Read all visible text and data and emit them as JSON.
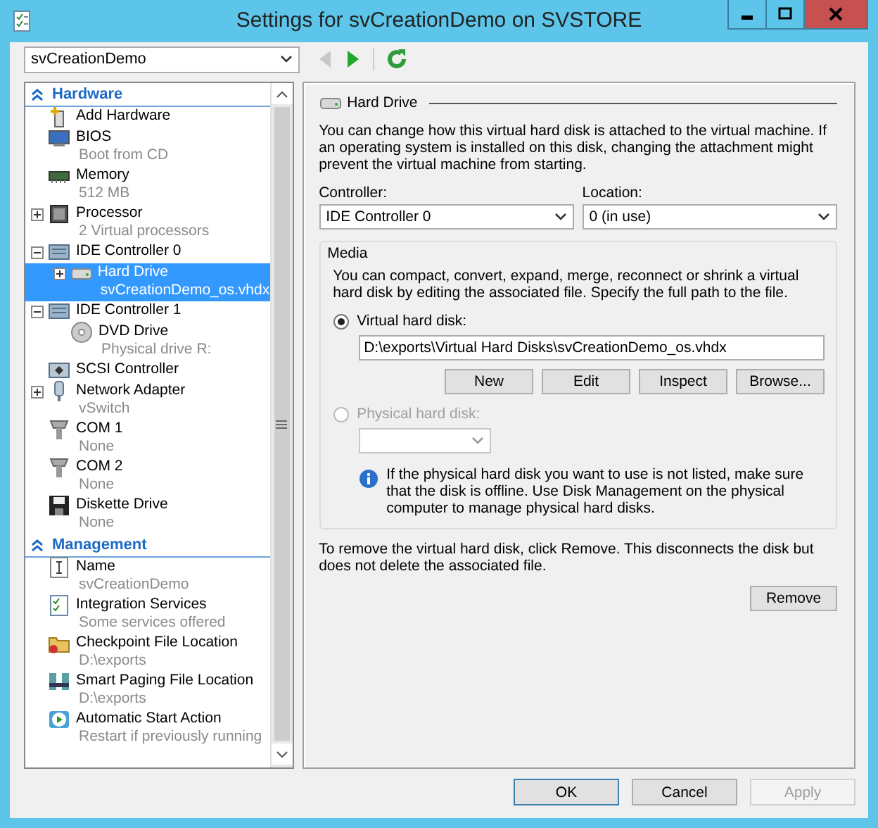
{
  "window": {
    "title": "Settings for svCreationDemo on SVSTORE"
  },
  "vm_selector": {
    "value": "svCreationDemo"
  },
  "toolbar": {
    "back_disabled": true,
    "forward_disabled": false
  },
  "sidebar": {
    "sections": [
      {
        "title": "Hardware",
        "items": [
          {
            "label": "Add Hardware",
            "selected": false
          },
          {
            "label": "BIOS",
            "detail": "Boot from CD",
            "selected": false
          },
          {
            "label": "Memory",
            "detail": "512 MB",
            "selected": false
          },
          {
            "label": "Processor",
            "detail": "2 Virtual processors",
            "selected": false,
            "expanded": false
          },
          {
            "label": "IDE Controller 0",
            "selected": false,
            "expanded": true,
            "children": [
              {
                "label": "Hard Drive",
                "detail": "svCreationDemo_os.vhdx",
                "selected": true,
                "expanded": false
              }
            ]
          },
          {
            "label": "IDE Controller 1",
            "selected": false,
            "expanded": true,
            "children": [
              {
                "label": "DVD Drive",
                "detail": "Physical drive R:",
                "selected": false
              }
            ]
          },
          {
            "label": "SCSI Controller",
            "selected": false
          },
          {
            "label": "Network Adapter",
            "detail": "vSwitch",
            "selected": false,
            "expanded": false
          },
          {
            "label": "COM 1",
            "detail": "None",
            "selected": false
          },
          {
            "label": "COM 2",
            "detail": "None",
            "selected": false
          },
          {
            "label": "Diskette Drive",
            "detail": "None",
            "selected": false
          }
        ]
      },
      {
        "title": "Management",
        "items": [
          {
            "label": "Name",
            "detail": "svCreationDemo",
            "selected": false
          },
          {
            "label": "Integration Services",
            "detail": "Some services offered",
            "selected": false
          },
          {
            "label": "Checkpoint File Location",
            "detail": "D:\\exports",
            "selected": false
          },
          {
            "label": "Smart Paging File Location",
            "detail": "D:\\exports",
            "selected": false
          },
          {
            "label": "Automatic Start Action",
            "detail": "Restart if previously running",
            "selected": false
          }
        ]
      }
    ]
  },
  "panel": {
    "title": "Hard Drive",
    "intro": "You can change how this virtual hard disk is attached to the virtual machine. If an operating system is installed on this disk, changing the attachment might prevent the virtual machine from starting.",
    "controller": {
      "label": "Controller:",
      "value": "IDE Controller 0"
    },
    "location": {
      "label": "Location:",
      "value": "0 (in use)"
    },
    "media": {
      "title": "Media",
      "text": "You can compact, convert, expand, merge, reconnect or shrink a virtual hard disk by editing the associated file. Specify the full path to the file.",
      "virtual": {
        "label": "Virtual hard disk:",
        "selected": true,
        "disabled": false,
        "path": "D:\\exports\\Virtual Hard Disks\\svCreationDemo_os.vhdx"
      },
      "buttons": [
        "New",
        "Edit",
        "Inspect",
        "Browse..."
      ],
      "physical": {
        "label": "Physical hard disk:",
        "selected": false,
        "disabled": true
      },
      "info": "If the physical hard disk you want to use is not listed, make sure that the disk is offline. Use Disk Management on the physical computer to manage physical hard disks."
    },
    "remove_text": "To remove the virtual hard disk, click Remove. This disconnects the disk but does not delete the associated file.",
    "remove_button": "Remove"
  },
  "buttons": [
    {
      "label": "OK",
      "disabled": false,
      "default": true
    },
    {
      "label": "Cancel",
      "disabled": false,
      "default": false
    },
    {
      "label": "Apply",
      "disabled": true,
      "default": false
    }
  ]
}
